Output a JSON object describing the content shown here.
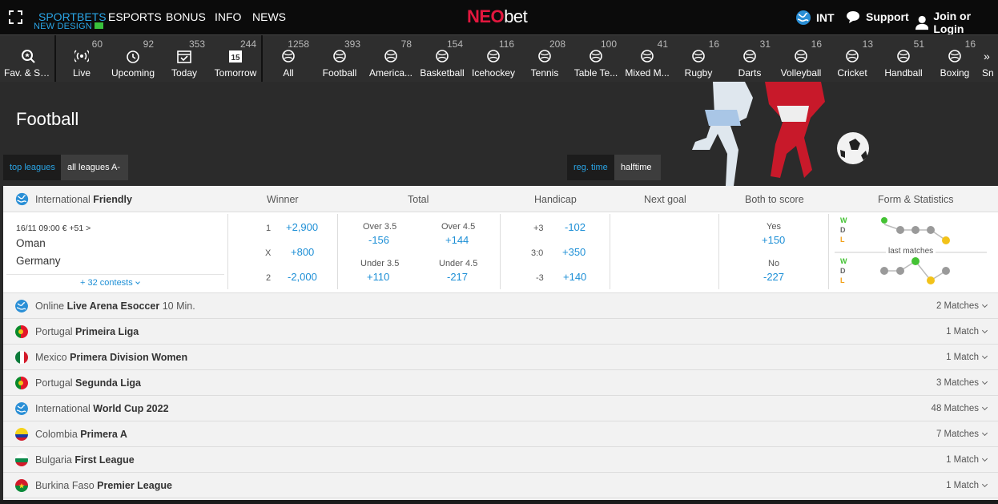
{
  "topnav": {
    "sportbets": "SPORTBETS",
    "new_design": "NEW DESIGN",
    "esports": "ESPORTS",
    "bonus": "BONUS",
    "info": "INFO",
    "news": "NEWS",
    "logo_a": "NEO",
    "logo_b": "bet",
    "region": "INT",
    "support": "Support",
    "login": "Join or Login"
  },
  "sports_strip": [
    {
      "label": "Fav. & Se...",
      "count": "",
      "icon": "search-star-icon"
    },
    {
      "label": "Live",
      "count": "60",
      "icon": "live-broadcast-icon"
    },
    {
      "label": "Upcoming",
      "count": "92",
      "icon": "clock-icon"
    },
    {
      "label": "Today",
      "count": "353",
      "icon": "calendar-check-icon"
    },
    {
      "label": "Tomorrow",
      "count": "244",
      "icon": "calendar-15-icon"
    },
    {
      "label": "All",
      "count": "1258",
      "icon": "all-sports-icon"
    },
    {
      "label": "Football",
      "count": "393",
      "icon": "football-icon"
    },
    {
      "label": "America...",
      "count": "78",
      "icon": "american-football-icon"
    },
    {
      "label": "Basketball",
      "count": "154",
      "icon": "basketball-icon"
    },
    {
      "label": "Icehockey",
      "count": "116",
      "icon": "icehockey-icon"
    },
    {
      "label": "Tennis",
      "count": "208",
      "icon": "tennis-icon"
    },
    {
      "label": "Table Te...",
      "count": "100",
      "icon": "table-tennis-icon"
    },
    {
      "label": "Mixed M...",
      "count": "41",
      "icon": "mma-glove-icon"
    },
    {
      "label": "Rugby",
      "count": "16",
      "icon": "rugby-icon"
    },
    {
      "label": "Darts",
      "count": "31",
      "icon": "darts-icon"
    },
    {
      "label": "Volleyball",
      "count": "16",
      "icon": "volleyball-icon"
    },
    {
      "label": "Cricket",
      "count": "13",
      "icon": "cricket-icon"
    },
    {
      "label": "Handball",
      "count": "51",
      "icon": "handball-icon"
    },
    {
      "label": "Boxing",
      "count": "16",
      "icon": "boxing-glove-icon"
    },
    {
      "label": "Sn",
      "count": "",
      "icon": "snooker-icon"
    }
  ],
  "hero": {
    "title": "Football",
    "top_leagues": "top leagues",
    "all_leagues": "all leagues A-Z",
    "reg_time": "reg. time",
    "halftime": "halftime"
  },
  "table_header": {
    "league_prefix": "International",
    "league_name": "Friendly",
    "winner": "Winner",
    "total": "Total",
    "handicap": "Handicap",
    "next_goal": "Next goal",
    "both_to_score": "Both to score",
    "form_stats": "Form & Statistics"
  },
  "match": {
    "datetime": "16/11 09:00",
    "currency": "€",
    "extra": "+51 >",
    "team1": "Oman",
    "team2": "Germany",
    "contests": "+ 32 contests",
    "winner": [
      {
        "label": "1",
        "odd": "+2,900"
      },
      {
        "label": "X",
        "odd": "+800"
      },
      {
        "label": "2",
        "odd": "-2,000"
      }
    ],
    "total": {
      "over35_label": "Over 3.5",
      "over35": "-156",
      "over45_label": "Over 4.5",
      "over45": "+144",
      "under35_label": "Under 3.5",
      "under35": "+110",
      "under45_label": "Under 4.5",
      "under45": "-217"
    },
    "handicap": [
      {
        "label": "+3",
        "odd": "-102"
      },
      {
        "label": "3:0",
        "odd": "+350"
      },
      {
        "label": "-3",
        "odd": "+140"
      }
    ],
    "btts": {
      "yes_label": "Yes",
      "yes": "+150",
      "no_label": "No",
      "no": "-227"
    },
    "form": {
      "w": "W",
      "d": "D",
      "l": "L",
      "last_matches": "last matches"
    }
  },
  "leagues": [
    {
      "country": "Online",
      "name": "Live Arena Esoccer",
      "suffix": "10 Min.",
      "count": "2 Matches",
      "flag": "globe"
    },
    {
      "country": "Portugal",
      "name": "Primeira Liga",
      "suffix": "",
      "count": "1 Match",
      "flag": "portugal"
    },
    {
      "country": "Mexico",
      "name": "Primera Division Women",
      "suffix": "",
      "count": "1 Match",
      "flag": "mexico"
    },
    {
      "country": "Portugal",
      "name": "Segunda Liga",
      "suffix": "",
      "count": "3 Matches",
      "flag": "portugal"
    },
    {
      "country": "International",
      "name": "World Cup 2022",
      "suffix": "",
      "count": "48 Matches",
      "flag": "globe"
    },
    {
      "country": "Colombia",
      "name": "Primera A",
      "suffix": "",
      "count": "7 Matches",
      "flag": "colombia"
    },
    {
      "country": "Bulgaria",
      "name": "First League",
      "suffix": "",
      "count": "1 Match",
      "flag": "bulgaria"
    },
    {
      "country": "Burkina Faso",
      "name": "Premier League",
      "suffix": "",
      "count": "1 Match",
      "flag": "burkina"
    }
  ],
  "colors": {
    "accent_blue": "#1d8fd6",
    "logo_red": "#e3173e",
    "form_green": "#44c234",
    "form_yellow": "#f2c219"
  }
}
